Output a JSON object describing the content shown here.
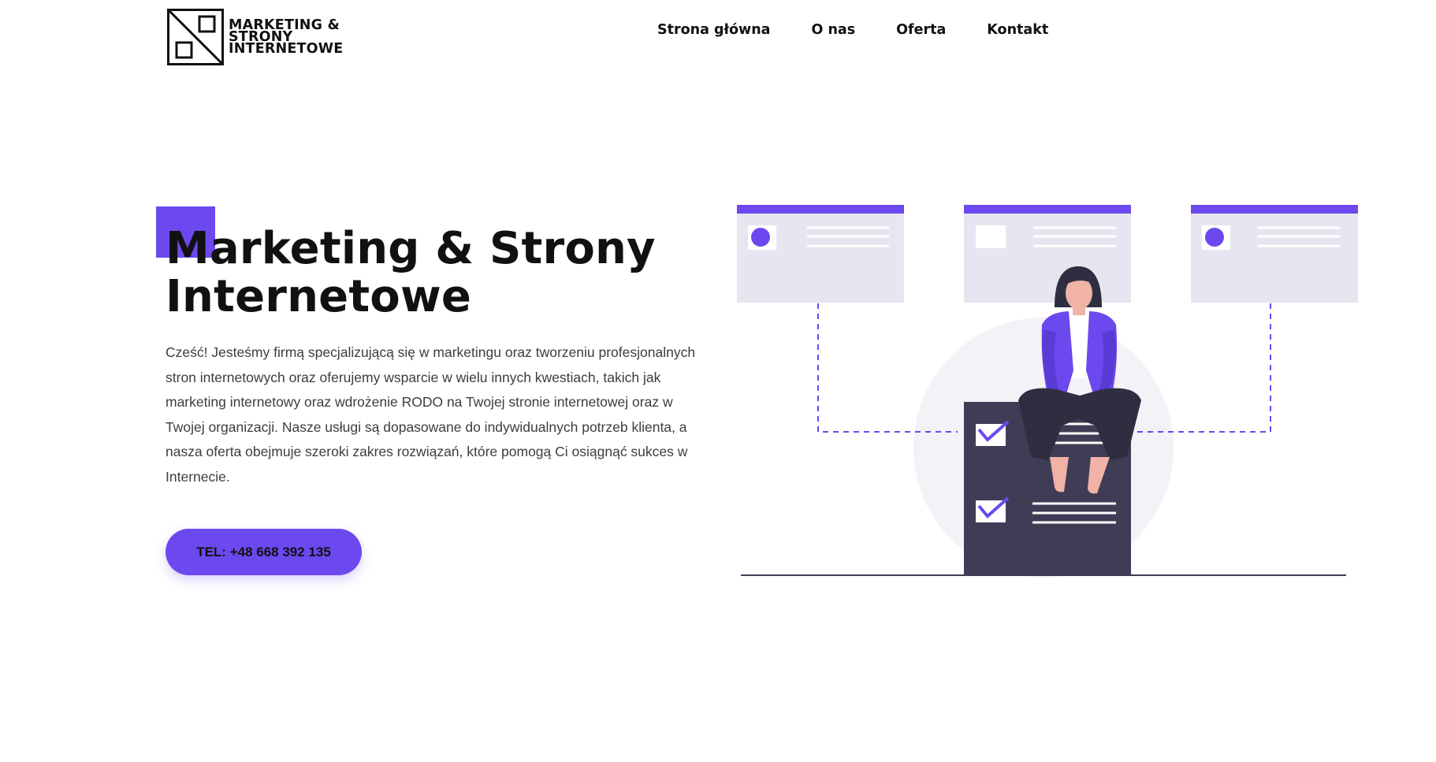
{
  "header": {
    "logo": {
      "lines": [
        "MARKETING &",
        "STRONY",
        "INTERNETOWE"
      ]
    },
    "nav": [
      "Strona główna",
      "O nas",
      "Oferta",
      "Kontakt"
    ]
  },
  "hero": {
    "title_line1": "Marketing & Strony",
    "title_line2": "Internetowe",
    "description": "Cześć! Jesteśmy firmą specjalizującą się w marketingu oraz tworzeniu profesjonalnych stron internetowych oraz oferujemy wsparcie w wielu innych kwestiach, takich jak marketing internetowy oraz wdrożenie RODO na Twojej stronie internetowej oraz w Twojej organizacji. Nasze usługi są dopasowane do indywidualnych potrzeb klienta, a nasza oferta obejmuje szeroki zakres rozwiązań, które pomogą Ci osiągnąć sukces w Internecie.",
    "cta_label": "TEL: +48 668 392 135"
  },
  "colors": {
    "accent": "#6c48ef",
    "text": "#111111",
    "body_text": "#3d3d3d",
    "card_bg": "#e6e6f0",
    "dark_block": "#3f3d56",
    "circle_bg": "#f2f2f7"
  },
  "illustration": {
    "icons": [
      "browser-card-icon",
      "checklist-icon",
      "sitting-woman-icon",
      "checkmark-icon"
    ]
  }
}
